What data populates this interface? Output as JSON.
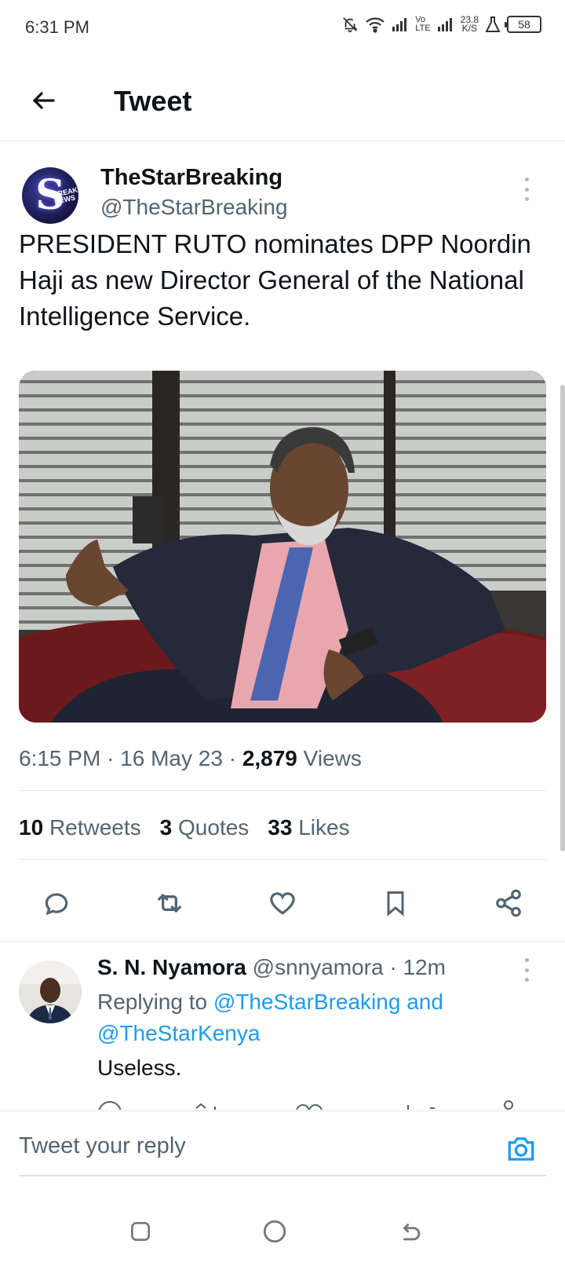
{
  "status_bar": {
    "time": "6:31 PM",
    "volte_top": "Vo",
    "volte_bottom": "LTE",
    "speed_value": "23.8",
    "speed_unit": "K/S",
    "battery": "58"
  },
  "header": {
    "title": "Tweet",
    "back_icon": "arrow-left-icon"
  },
  "tweet": {
    "author_name": "TheStarBreaking",
    "author_handle": "@TheStarBreaking",
    "text": "PRESIDENT RUTO nominates DPP Noordin Haji as new Director General of the National Intelligence Service.",
    "time": "6:15 PM",
    "date": "16 May 23",
    "views_count": "2,879",
    "views_label": "Views",
    "retweets_count": "10",
    "retweets_label": "Retweets",
    "quotes_count": "3",
    "quotes_label": "Quotes",
    "likes_count": "33",
    "likes_label": "Likes",
    "separator": "·"
  },
  "actions": [
    "reply-icon",
    "retweet-icon",
    "like-icon",
    "bookmark-icon",
    "share-icon"
  ],
  "reply": {
    "author_name": "S. N. Nyamora",
    "author_handle": "@snnyamora",
    "age": "12m",
    "replying_prefix": "Replying to",
    "replying_to_1": "@TheStarBreaking and",
    "replying_to_2": "@TheStarKenya",
    "text": "Useless."
  },
  "composer": {
    "placeholder": "Tweet your reply",
    "camera_icon": "camera-icon"
  },
  "colors": {
    "accent": "#1d9bf0",
    "text_primary": "#0f1419",
    "text_secondary": "#536471"
  }
}
